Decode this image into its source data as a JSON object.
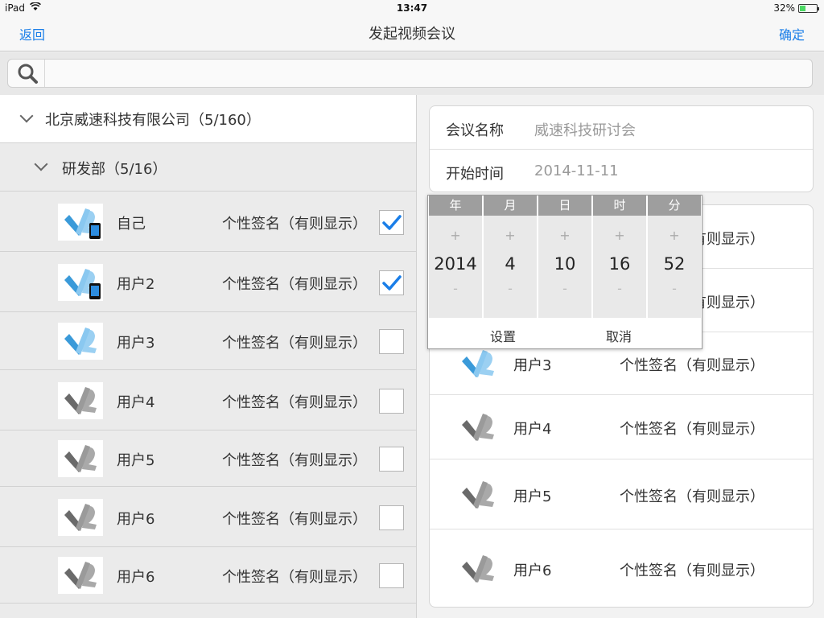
{
  "statusbar": {
    "device": "iPad",
    "time": "13:47",
    "battery": "32%"
  },
  "nav": {
    "back": "返回",
    "title": "发起视频会议",
    "confirm": "确定"
  },
  "search": {
    "placeholder": ""
  },
  "tree": {
    "company": "北京威速科技有限公司（5/160）",
    "department": "研发部（5/16）",
    "members": [
      {
        "name": "自己",
        "signature": "个性签名（有则显示）",
        "checked": true,
        "avatar": "blue-mobile"
      },
      {
        "name": "用户2",
        "signature": "个性签名（有则显示）",
        "checked": true,
        "avatar": "blue-mobile"
      },
      {
        "name": "用户3",
        "signature": "个性签名（有则显示）",
        "checked": false,
        "avatar": "blue"
      },
      {
        "name": "用户4",
        "signature": "个性签名（有则显示）",
        "checked": false,
        "avatar": "gray"
      },
      {
        "name": "用户5",
        "signature": "个性签名（有则显示）",
        "checked": false,
        "avatar": "gray"
      },
      {
        "name": "用户6",
        "signature": "个性签名（有则显示）",
        "checked": false,
        "avatar": "gray"
      },
      {
        "name": "用户6",
        "signature": "个性签名（有则显示）",
        "checked": false,
        "avatar": "gray"
      }
    ]
  },
  "form": {
    "name_label": "会议名称",
    "name_value": "威速科技研讨会",
    "start_label": "开始时间",
    "start_value": "2014-11-11"
  },
  "selected": [
    {
      "name": "",
      "signature": "个性签名（有则显示）",
      "avatar": "blue"
    },
    {
      "name": "",
      "signature": "个性签名（有则显示）",
      "avatar": "blue"
    },
    {
      "name": "用户3",
      "signature": "个性签名（有则显示）",
      "avatar": "blue"
    },
    {
      "name": "用户4",
      "signature": "个性签名（有则显示）",
      "avatar": "gray"
    },
    {
      "name": "用户5",
      "signature": "个性签名（有则显示）",
      "avatar": "gray"
    },
    {
      "name": "用户6",
      "signature": "个性签名（有则显示）",
      "avatar": "gray"
    }
  ],
  "picker": {
    "columns": [
      {
        "header": "年",
        "value": "2014"
      },
      {
        "header": "月",
        "value": "4"
      },
      {
        "header": "日",
        "value": "10"
      },
      {
        "header": "时",
        "value": "16"
      },
      {
        "header": "分",
        "value": "52"
      }
    ],
    "plus": "+",
    "minus": "-",
    "set": "设置",
    "cancel": "取消"
  },
  "colors": {
    "accent": "#1a7ee8",
    "blue_avatar": "#3a9ad9",
    "gray_avatar": "#6a6a6a"
  }
}
